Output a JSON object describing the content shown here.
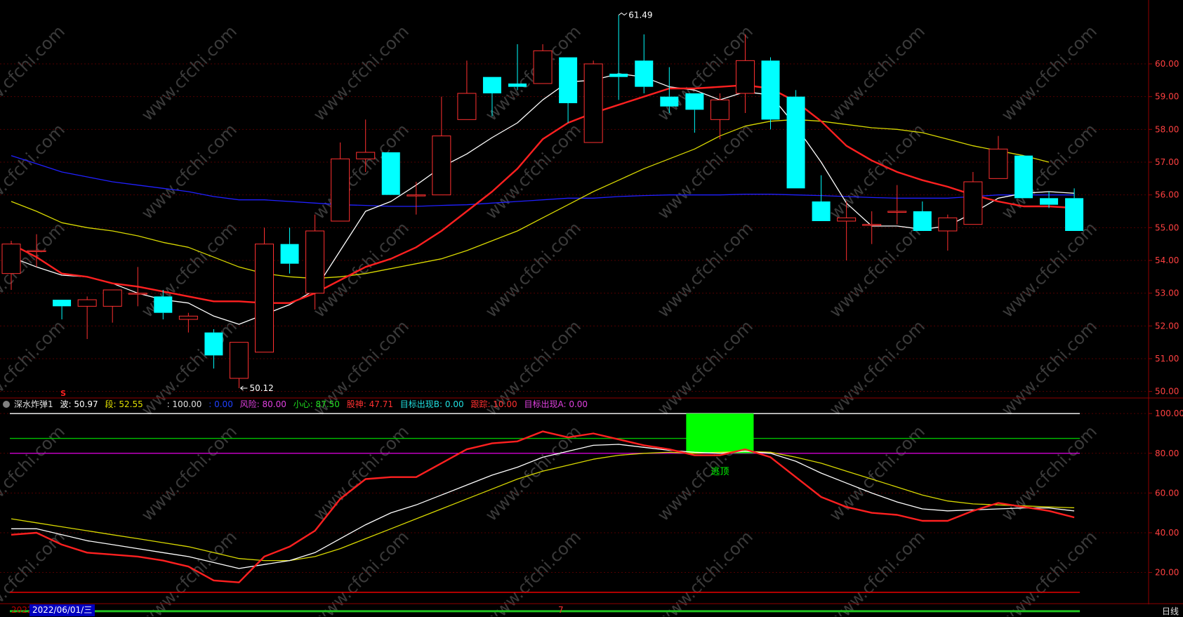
{
  "candles": [
    {
      "o": 53.6,
      "h": 54.6,
      "l": 53.1,
      "c": 54.5
    },
    {
      "o": 54.3,
      "h": 54.8,
      "l": 53.8,
      "c": 54.3
    },
    {
      "o": 52.8,
      "h": 52.8,
      "l": 52.2,
      "c": 52.6
    },
    {
      "o": 52.6,
      "h": 52.9,
      "l": 51.6,
      "c": 52.8
    },
    {
      "o": 52.6,
      "h": 53.1,
      "l": 52.1,
      "c": 53.1
    },
    {
      "o": 53.0,
      "h": 53.8,
      "l": 52.6,
      "c": 53.0
    },
    {
      "o": 52.9,
      "h": 53.1,
      "l": 52.2,
      "c": 52.4
    },
    {
      "o": 52.2,
      "h": 52.4,
      "l": 51.8,
      "c": 52.3
    },
    {
      "o": 51.8,
      "h": 51.9,
      "l": 50.7,
      "c": 51.1
    },
    {
      "o": 50.4,
      "h": 51.5,
      "l": 50.1,
      "c": 51.5
    },
    {
      "o": 51.2,
      "h": 55.0,
      "l": 51.2,
      "c": 54.5
    },
    {
      "o": 54.5,
      "h": 55.0,
      "l": 53.6,
      "c": 53.9
    },
    {
      "o": 53.0,
      "h": 55.4,
      "l": 52.5,
      "c": 54.9
    },
    {
      "o": 55.2,
      "h": 57.6,
      "l": 55.2,
      "c": 57.1
    },
    {
      "o": 57.1,
      "h": 58.3,
      "l": 56.7,
      "c": 57.3
    },
    {
      "o": 57.3,
      "h": 57.3,
      "l": 56.0,
      "c": 56.0
    },
    {
      "o": 56.0,
      "h": 56.4,
      "l": 55.4,
      "c": 56.0
    },
    {
      "o": 56.0,
      "h": 59.0,
      "l": 56.0,
      "c": 57.8
    },
    {
      "o": 58.3,
      "h": 60.1,
      "l": 58.3,
      "c": 59.1
    },
    {
      "o": 59.6,
      "h": 59.6,
      "l": 58.4,
      "c": 59.1
    },
    {
      "o": 59.4,
      "h": 60.6,
      "l": 59.2,
      "c": 59.3
    },
    {
      "o": 59.4,
      "h": 60.6,
      "l": 59.4,
      "c": 60.4
    },
    {
      "o": 60.2,
      "h": 60.2,
      "l": 58.2,
      "c": 58.8
    },
    {
      "o": 57.6,
      "h": 60.1,
      "l": 57.6,
      "c": 60.0
    },
    {
      "o": 59.7,
      "h": 61.49,
      "l": 58.9,
      "c": 59.6
    },
    {
      "o": 60.1,
      "h": 60.9,
      "l": 59.1,
      "c": 59.3
    },
    {
      "o": 59.0,
      "h": 59.9,
      "l": 58.5,
      "c": 58.7
    },
    {
      "o": 59.1,
      "h": 59.1,
      "l": 57.9,
      "c": 58.6
    },
    {
      "o": 58.3,
      "h": 59.1,
      "l": 57.7,
      "c": 58.9
    },
    {
      "o": 59.1,
      "h": 60.9,
      "l": 58.5,
      "c": 60.1
    },
    {
      "o": 60.1,
      "h": 60.2,
      "l": 58.0,
      "c": 58.3
    },
    {
      "o": 59.0,
      "h": 59.2,
      "l": 56.2,
      "c": 56.2
    },
    {
      "o": 55.8,
      "h": 56.6,
      "l": 55.2,
      "c": 55.2
    },
    {
      "o": 55.2,
      "h": 55.8,
      "l": 54.0,
      "c": 55.3
    },
    {
      "o": 55.1,
      "h": 55.5,
      "l": 54.5,
      "c": 55.1
    },
    {
      "o": 55.5,
      "h": 56.3,
      "l": 55.1,
      "c": 55.5
    },
    {
      "o": 55.5,
      "h": 55.8,
      "l": 54.9,
      "c": 54.9
    },
    {
      "o": 54.9,
      "h": 55.4,
      "l": 54.3,
      "c": 55.3
    },
    {
      "o": 55.1,
      "h": 56.7,
      "l": 55.1,
      "c": 56.4
    },
    {
      "o": 56.5,
      "h": 57.8,
      "l": 56.5,
      "c": 57.4
    },
    {
      "o": 57.2,
      "h": 57.2,
      "l": 55.9,
      "c": 55.9
    },
    {
      "o": 55.9,
      "h": 56.1,
      "l": 55.6,
      "c": 55.7
    },
    {
      "o": 55.9,
      "h": 56.2,
      "l": 54.9,
      "c": 54.9
    }
  ],
  "chart_data": [
    {
      "type": "candlestick",
      "title": "",
      "ylim": [
        49.8,
        61.8
      ],
      "yticks": [
        "50.00",
        "51.00",
        "52.00",
        "53.00",
        "54.00",
        "55.00",
        "56.00",
        "57.00",
        "58.00",
        "59.00",
        "60.00"
      ],
      "annotations": {
        "high_label": "61.49",
        "low_label": "50.12"
      },
      "series": [
        {
          "name": "",
          "color": "#ffffff",
          "values": [
            54.1,
            53.8,
            53.55,
            53.5,
            53.3,
            53.0,
            52.8,
            52.7,
            52.3,
            52.05,
            52.35,
            52.65,
            53.1,
            54.3,
            55.5,
            55.8,
            56.3,
            56.85,
            57.25,
            57.75,
            58.2,
            58.9,
            59.45,
            59.5,
            59.7,
            59.6,
            59.3,
            59.2,
            58.9,
            59.15,
            59.05,
            58.1,
            57.0,
            55.75,
            55.05,
            55.05,
            54.95,
            55.05,
            55.45,
            55.9,
            56.05,
            56.1,
            56.05
          ]
        },
        {
          "name": "",
          "color": "#ff2020",
          "values": [
            54.5,
            54.1,
            53.6,
            53.5,
            53.3,
            53.2,
            53.05,
            52.9,
            52.75,
            52.75,
            52.7,
            52.7,
            53.0,
            53.4,
            53.8,
            54.05,
            54.4,
            54.9,
            55.5,
            56.1,
            56.8,
            57.7,
            58.2,
            58.5,
            58.75,
            59.0,
            59.25,
            59.25,
            59.3,
            59.35,
            59.25,
            58.85,
            58.25,
            57.5,
            57.05,
            56.7,
            56.45,
            56.25,
            56.0,
            55.8,
            55.65,
            55.65,
            55.6
          ]
        },
        {
          "name": "",
          "color": "#d8d800",
          "values": [
            55.8,
            55.5,
            55.15,
            55.0,
            54.9,
            54.75,
            54.55,
            54.4,
            54.1,
            53.8,
            53.6,
            53.5,
            53.45,
            53.5,
            53.6,
            53.75,
            53.9,
            54.05,
            54.3,
            54.6,
            54.9,
            55.3,
            55.7,
            56.1,
            56.45,
            56.8,
            57.1,
            57.4,
            57.8,
            58.1,
            58.25,
            58.3,
            58.25,
            58.15,
            58.05,
            58.0,
            57.9,
            57.7,
            57.5,
            57.35,
            57.2,
            57.0
          ]
        },
        {
          "name": "",
          "color": "#2020ff",
          "values": [
            57.2,
            56.95,
            56.7,
            56.55,
            56.4,
            56.3,
            56.2,
            56.1,
            55.95,
            55.85,
            55.85,
            55.8,
            55.75,
            55.7,
            55.68,
            55.65,
            55.65,
            55.68,
            55.7,
            55.75,
            55.8,
            55.85,
            55.9,
            55.9,
            55.95,
            55.98,
            56.0,
            56.0,
            56.0,
            56.02,
            56.02,
            56.0,
            55.98,
            55.95,
            55.92,
            55.9,
            55.9,
            55.9,
            55.95,
            56.0,
            56.0,
            56.0,
            56.0
          ]
        }
      ]
    },
    {
      "type": "line",
      "title": "",
      "ylim": [
        5,
        105
      ],
      "yticks": [
        "20.00",
        "40.00",
        "60.00",
        "80.00",
        "100.00"
      ],
      "ref_lines": [
        {
          "value": 100,
          "color": "#ffffff"
        },
        {
          "value": 87.5,
          "color": "#00c000"
        },
        {
          "value": 80,
          "color": "#c000c0"
        },
        {
          "value": 10,
          "color": "#ff0000"
        },
        {
          "value": 0.5,
          "color": "#20c020"
        }
      ],
      "signal": {
        "label": "逃顶",
        "from_index": 27,
        "to_index": 29,
        "y_from": 80,
        "y_to": 100,
        "color": "#00ff00"
      },
      "series": [
        {
          "name": "",
          "color": "#ff2020",
          "values": [
            39,
            40,
            34,
            30,
            29,
            28,
            26,
            23,
            16,
            15,
            28,
            33,
            41,
            57,
            67,
            68,
            68,
            75,
            82,
            85,
            86,
            91,
            88,
            90,
            87,
            84,
            82,
            79,
            79,
            82,
            78,
            68,
            58,
            53,
            50,
            49,
            46,
            46,
            51,
            55,
            53,
            51,
            47.71
          ]
        },
        {
          "name": "",
          "color": "#ffffff",
          "values": [
            42,
            42,
            39,
            36,
            34,
            32,
            30,
            28,
            25,
            22,
            24,
            26,
            30,
            37,
            44,
            50,
            54,
            59,
            64,
            69,
            73,
            78,
            81,
            84,
            84.5,
            83,
            81.5,
            80.5,
            80,
            81,
            80,
            76,
            70,
            65,
            60,
            55.5,
            52,
            51,
            51.5,
            52,
            52.5,
            52.5,
            50.97
          ]
        },
        {
          "name": "",
          "color": "#d8d800",
          "values": [
            47,
            45,
            43,
            41,
            39,
            37,
            35,
            33,
            30,
            27,
            26,
            26,
            28,
            32,
            37,
            42,
            47,
            52,
            57,
            62,
            67,
            71,
            74,
            77,
            79,
            80,
            80.5,
            80,
            80.5,
            81,
            80.5,
            78,
            75,
            71,
            67,
            63,
            59,
            56,
            54.5,
            54,
            53.5,
            53,
            52.55
          ]
        }
      ]
    }
  ],
  "indicator": {
    "name": "深水炸弹1",
    "wave": "波: 50.97",
    "segment": "段: 52.55",
    "hundred": ": 100.00",
    "zero": ": 0.00",
    "risk": "风险: 80.00",
    "caution": "小心: 87.50",
    "stock_god": "股神: 47.71",
    "target_b": "目标出现B: 0.00",
    "trace": "跟踪: 10.00",
    "target_a": "目标出现A: 0.00"
  },
  "markers": {
    "s_label": "S"
  },
  "bottom": {
    "year": "2022",
    "date": "2022/06/01/三",
    "month": "7",
    "period": "日线"
  },
  "watermark": "www.cfchi.com",
  "colors": {
    "up": "#ff3030",
    "down": "#00ffff",
    "axis": "#900000",
    "grid": "#500000",
    "tick_text": "#ff4040",
    "annotation": "#ffffff"
  }
}
